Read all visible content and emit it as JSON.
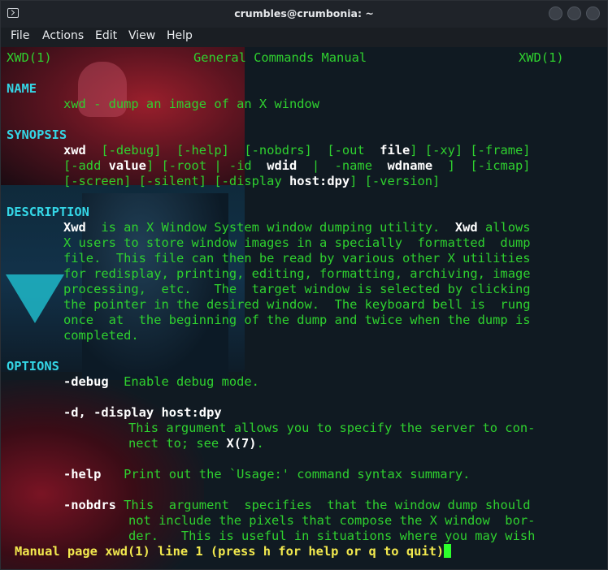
{
  "window": {
    "title": "crumbles@crumbonia: ~",
    "icon": "terminal-icon"
  },
  "menu": [
    "File",
    "Actions",
    "Edit",
    "View",
    "Help"
  ],
  "man": {
    "header_left": "XWD(1)",
    "header_center": "General Commands Manual",
    "header_right": "XWD(1)",
    "sections": {
      "name": "NAME",
      "synopsis": "SYNOPSIS",
      "description": "DESCRIPTION",
      "options": "OPTIONS"
    },
    "name_text": "xwd - dump an image of an X window",
    "synopsis": {
      "cmd": "xwd",
      "l1a": "  [-debug]  [-help]  [-nobdrs]  [-out  ",
      "file": "file",
      "l1b": "] [-xy] [-frame]",
      "l2a": "[-add ",
      "value": "value",
      "l2b": "] [-root | -id  ",
      "wdid": "wdid",
      "l2c": "  |  -name  ",
      "wdname": "wdname",
      "l2d": "  ]  [-icmap]",
      "l3a": "[-screen] [-silent] [-display ",
      "hostdpy": "host:dpy",
      "l3b": "] [-version]"
    },
    "description": {
      "xwd1": "Xwd",
      "l1": "  is an X Window System window dumping utility.  ",
      "xwd2": "Xwd",
      "l1b": " allows",
      "lines": [
        "X users to store window images in a specially  formatted  dump",
        "file.  This file can then be read by various other X utilities",
        "for redisplay, printing, editing, formatting, archiving, image",
        "processing,  etc.   The  target window is selected by clicking",
        "the pointer in the desired window.  The keyboard bell is  rung",
        "once  at  the beginning of the dump and twice when the dump is",
        "completed."
      ]
    },
    "options": {
      "debug_flag": "-debug",
      "debug_text": "  Enable debug mode.",
      "display_flag": "-d, -display ",
      "display_arg": "host:dpy",
      "display_l1": "This argument allows you to specify the server to con-",
      "display_l2a": "nect to; see ",
      "display_ref": "X(7)",
      "display_l2b": ".",
      "help_flag": "-help",
      "help_text": "   Print out the `Usage:' command syntax summary.",
      "nobdrs_flag": "-nobdrs",
      "nobdrs_l1": " This  argument  specifies  that the window dump should",
      "nobdrs_l2": "not include the pixels that compose the X window  bor-",
      "nobdrs_l3": "der.   This is useful in situations where you may wish"
    },
    "status": "Manual page xwd(1) line 1 (press h for help or q to quit)"
  }
}
